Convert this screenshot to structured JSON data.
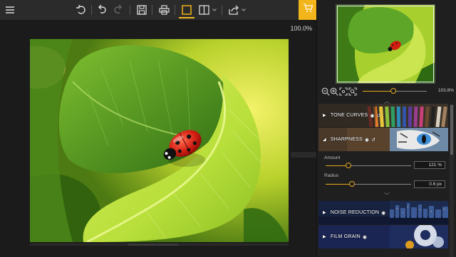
{
  "toolbar": {
    "buttons": [
      "menu-icon",
      "undo-icon",
      "redo-icon",
      "redo-disabled-icon",
      "save-icon",
      "print-icon",
      "single-view-icon",
      "split-view-icon",
      "share-icon",
      "cart-icon"
    ],
    "accent_color": "#f2b51b"
  },
  "canvas": {
    "zoom_label": "100.0%"
  },
  "navigator": {
    "zoom_value": "103.8%",
    "zoom_level": 0.48
  },
  "sections": {
    "tone_curves": "TONE CURVES",
    "sharpness": "SHARPNESS",
    "noise_reduction": "NOISE REDUCTION",
    "film_grain": "FILM GRAIN"
  },
  "sharpness": {
    "amount_label": "Amount",
    "amount_value": "121 %",
    "amount_level": 0.27,
    "radius_label": "Radius",
    "radius_value": "0.6 px",
    "radius_level": 0.31
  }
}
